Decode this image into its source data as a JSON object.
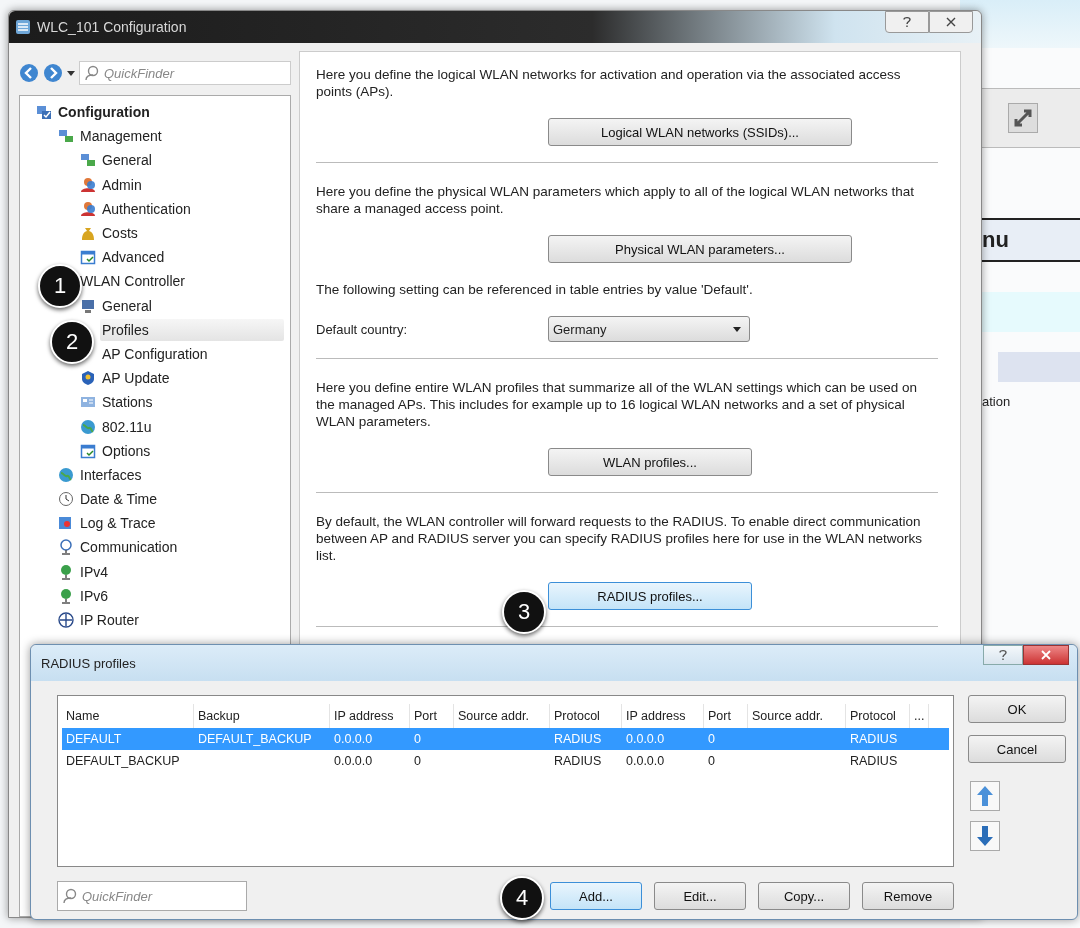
{
  "background_app": {
    "heading": "nu",
    "column_header": "ation"
  },
  "window": {
    "title": "WLC_101 Configuration"
  },
  "navigation": {
    "quickfinder_placeholder": "QuickFinder",
    "tree": [
      {
        "label": "Configuration",
        "kind": "config",
        "selected": false,
        "children": [
          {
            "label": "Management",
            "kind": "computers",
            "selected": false,
            "children": [
              {
                "label": "General",
                "kind": "computers",
                "selected": false
              },
              {
                "label": "Admin",
                "kind": "person",
                "selected": false
              },
              {
                "label": "Authentication",
                "kind": "person",
                "selected": false
              },
              {
                "label": "Costs",
                "kind": "bag",
                "selected": false
              },
              {
                "label": "Advanced",
                "kind": "window",
                "selected": false
              }
            ]
          },
          {
            "label": "WLAN Controller",
            "kind": "none",
            "selected": false,
            "children": [
              {
                "label": "General",
                "kind": "monitor",
                "selected": false
              },
              {
                "label": "Profiles",
                "kind": "none",
                "selected": true
              },
              {
                "label": "AP Configuration",
                "kind": "none",
                "selected": false
              },
              {
                "label": "AP Update",
                "kind": "shield",
                "selected": false
              },
              {
                "label": "Stations",
                "kind": "stations",
                "selected": false
              },
              {
                "label": "802.11u",
                "kind": "globe",
                "selected": false
              },
              {
                "label": "Options",
                "kind": "window",
                "selected": false
              }
            ]
          },
          {
            "label": "Interfaces",
            "kind": "globe",
            "selected": false
          },
          {
            "label": "Date & Time",
            "kind": "clock",
            "selected": false
          },
          {
            "label": "Log & Trace",
            "kind": "log",
            "selected": false
          },
          {
            "label": "Communication",
            "kind": "satellite",
            "selected": false
          },
          {
            "label": "IPv4",
            "kind": "pin",
            "selected": false
          },
          {
            "label": "IPv6",
            "kind": "pin",
            "selected": false
          },
          {
            "label": "IP Router",
            "kind": "router",
            "selected": false
          }
        ]
      }
    ]
  },
  "sections": [
    {
      "text": "Here you define the logical WLAN networks for activation and operation via the associated access points (APs).",
      "button": "Logical WLAN networks (SSIDs)...",
      "wide": true,
      "focused": false
    },
    {
      "text": "Here you define the physical WLAN parameters which apply to all of the logical WLAN networks that share a managed access point.",
      "button": "Physical WLAN parameters...",
      "wide": true,
      "focused": false,
      "note": "The following setting can be referenced in table entries by value 'Default'.",
      "field": {
        "label": "Default country:",
        "value": "Germany"
      }
    },
    {
      "text": "Here you define entire WLAN profiles that summarize all of the WLAN settings which can be used on the managed APs. This includes for example up to 16 logical WLAN networks and a set of physical WLAN parameters.",
      "button": "WLAN profiles...",
      "wide": false,
      "focused": false
    },
    {
      "text": "By default, the WLAN controller will forward requests to the RADIUS. To enable direct communication between AP and RADIUS server you can specify RADIUS profiles here for use in the WLAN networks list.",
      "button": "RADIUS profiles...",
      "wide": false,
      "focused": true
    }
  ],
  "dialog": {
    "title": "RADIUS profiles",
    "columns": [
      "Name",
      "Backup",
      "IP address",
      "Port",
      "Source addr.",
      "Protocol",
      "IP address",
      "Port",
      "Source addr.",
      "Protocol",
      "..."
    ],
    "rows": [
      {
        "cells": [
          "DEFAULT",
          "DEFAULT_BACKUP",
          "0.0.0.0",
          "0",
          "",
          "RADIUS",
          "0.0.0.0",
          "0",
          "",
          "RADIUS",
          ""
        ],
        "selected": true
      },
      {
        "cells": [
          "DEFAULT_BACKUP",
          "",
          "0.0.0.0",
          "0",
          "",
          "RADIUS",
          "0.0.0.0",
          "0",
          "",
          "RADIUS",
          ""
        ],
        "selected": false
      }
    ],
    "side_buttons": [
      "OK",
      "Cancel"
    ],
    "quickfinder_placeholder": "QuickFinder",
    "bottom_buttons": [
      {
        "label": "Add...",
        "focused": true
      },
      {
        "label": "Edit...",
        "focused": false
      },
      {
        "label": "Copy...",
        "focused": false
      },
      {
        "label": "Remove",
        "focused": false
      }
    ]
  },
  "step_markers": [
    "1",
    "2",
    "3",
    "4"
  ]
}
